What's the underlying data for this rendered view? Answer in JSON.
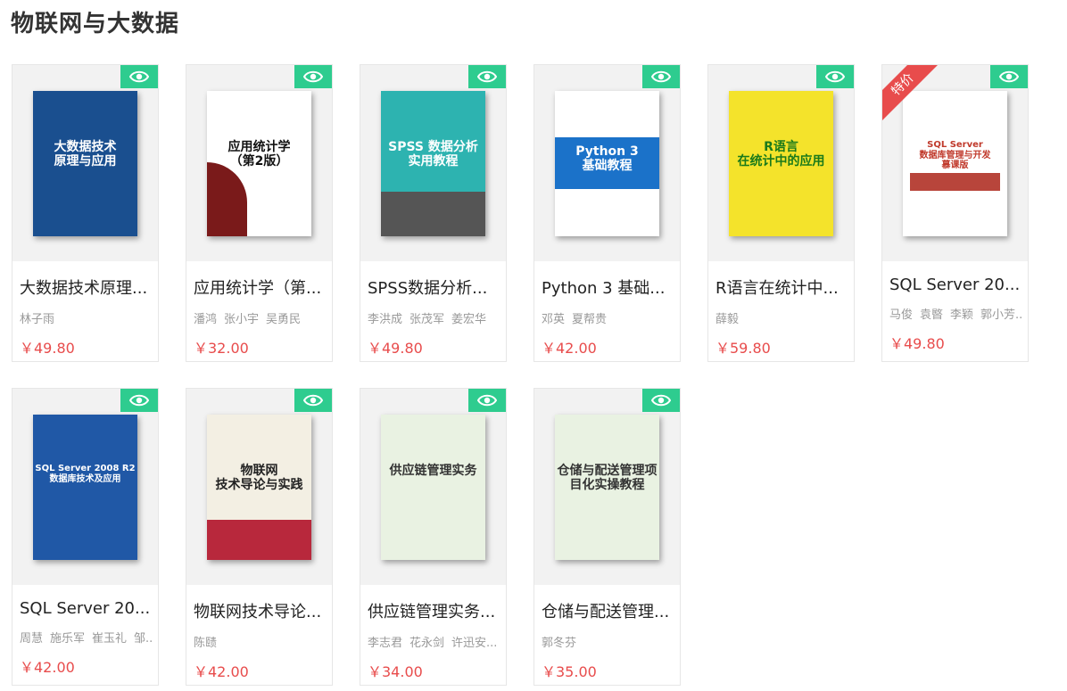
{
  "section": {
    "title": "物联网与大数据"
  },
  "badge_color": "#2ecc8f",
  "ribbon_label": "特价",
  "books": [
    {
      "title": "大数据技术原理...",
      "authors": [
        "林子雨"
      ],
      "price": "￥49.80",
      "cover": {
        "bg": "#1a4f8f",
        "text": "大数据技术\n原理与应用",
        "fg": "#ffffff"
      }
    },
    {
      "title": "应用统计学（第...",
      "authors": [
        "潘鸿",
        "张小宇",
        "吴勇民"
      ],
      "price": "￥32.00",
      "cover": {
        "bg": "#ffffff",
        "text": "应用统计学\n（第2版）",
        "fg": "#111111"
      }
    },
    {
      "title": "SPSS数据分析...",
      "authors": [
        "李洪成",
        "张茂军",
        "姜宏华"
      ],
      "price": "￥49.80",
      "cover": {
        "bg": "#2db3b0",
        "text": "SPSS 数据分析\n实用教程",
        "fg": "#ffffff"
      }
    },
    {
      "title": "Python 3 基础...",
      "authors": [
        "邓英",
        "夏帮贵"
      ],
      "price": "￥42.00",
      "cover": {
        "bg": "#ffffff",
        "text": "Python 3\n基础教程",
        "fg": "#ffffff"
      }
    },
    {
      "title": "R语言在统计中...",
      "authors": [
        "薛毅"
      ],
      "price": "￥59.80",
      "cover": {
        "bg": "#f4e32b",
        "text": "R语言\n在统计中的应用",
        "fg": "#1a7a1a"
      }
    },
    {
      "title": "SQL Server 20...",
      "authors": [
        "马俊",
        "袁暋",
        "李颖",
        "郭小芳..."
      ],
      "price": "￥49.80",
      "cover": {
        "bg": "#ffffff",
        "text": "SQL Server\n数据库管理与开发\n慕课版",
        "fg": "#c0392b"
      }
    },
    {
      "title": "SQL Server 20...",
      "authors": [
        "周慧",
        "施乐军",
        "崔玉礼",
        "邹..."
      ],
      "price": "￥42.00",
      "cover": {
        "bg": "#2058a6",
        "text": "SQL Server 2008 R2\n数据库技术及应用",
        "fg": "#ffffff"
      }
    },
    {
      "title": "物联网技术导论...",
      "authors": [
        "陈赜"
      ],
      "price": "￥42.00",
      "cover": {
        "bg": "#f3efe3",
        "text": "物联网\n技术导论与实践",
        "fg": "#222222"
      }
    },
    {
      "title": "供应链管理实务...",
      "authors": [
        "李志君",
        "花永剑",
        "许迅安..."
      ],
      "price": "￥34.00",
      "cover": {
        "bg": "#e9f2e2",
        "text": "供应链管理实务",
        "fg": "#333333"
      }
    },
    {
      "title": "仓储与配送管理...",
      "authors": [
        "郭冬芬"
      ],
      "price": "￥35.00",
      "cover": {
        "bg": "#e9f2e2",
        "text": "仓储与配送管理项目化实操教程",
        "fg": "#333333"
      }
    }
  ]
}
